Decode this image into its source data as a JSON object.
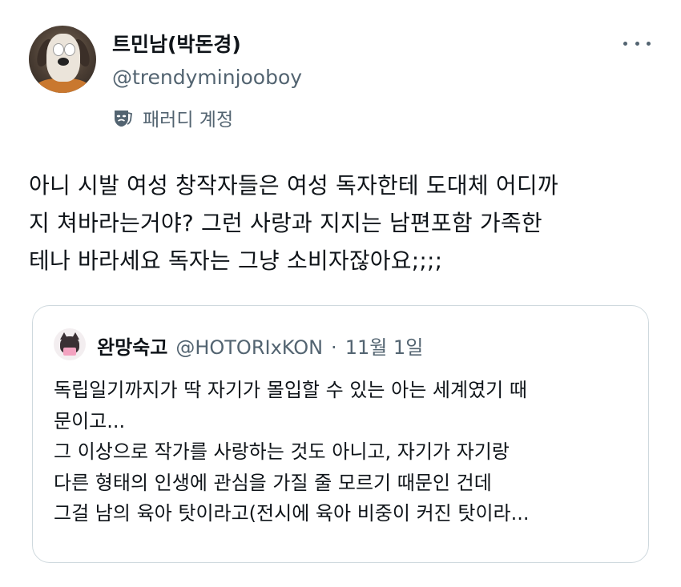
{
  "author": {
    "display_name": "트민남(박돈경)",
    "handle": "@trendyminjooboy",
    "label": "패러디 계정"
  },
  "tweet": {
    "lines": [
      "아니 시발 여성 창작자들은 여성 독자한테 도대체 어디까",
      "지 쳐바라는거야? 그런 사랑과 지지는 남편포함 가족한",
      "테나 바라세요 독자는 그냥 소비자잖아요;;;;"
    ]
  },
  "quote": {
    "display_name": "완망숙고",
    "handle": "@HOTORIxKON",
    "separator": "·",
    "date": "11월 1일",
    "lines": [
      "독립일기까지가 딱 자기가 몰입할 수 있는 아는 세계였기 때",
      "문이고...",
      "그 이상으로 작가를 사랑하는 것도 아니고, 자기가 자기랑",
      "다른 형태의 인생에 관심을 가질 줄 모르기 때문인 건데",
      "그걸 남의 육아 탓이라고(전시에 육아 비중이 커진 탓이라..."
    ]
  },
  "icons": {
    "more": "more-horizontal-icon",
    "parody": "theater-mask-icon"
  },
  "colors": {
    "text": "#0f1419",
    "secondary": "#536471",
    "border": "#cfd9de"
  }
}
